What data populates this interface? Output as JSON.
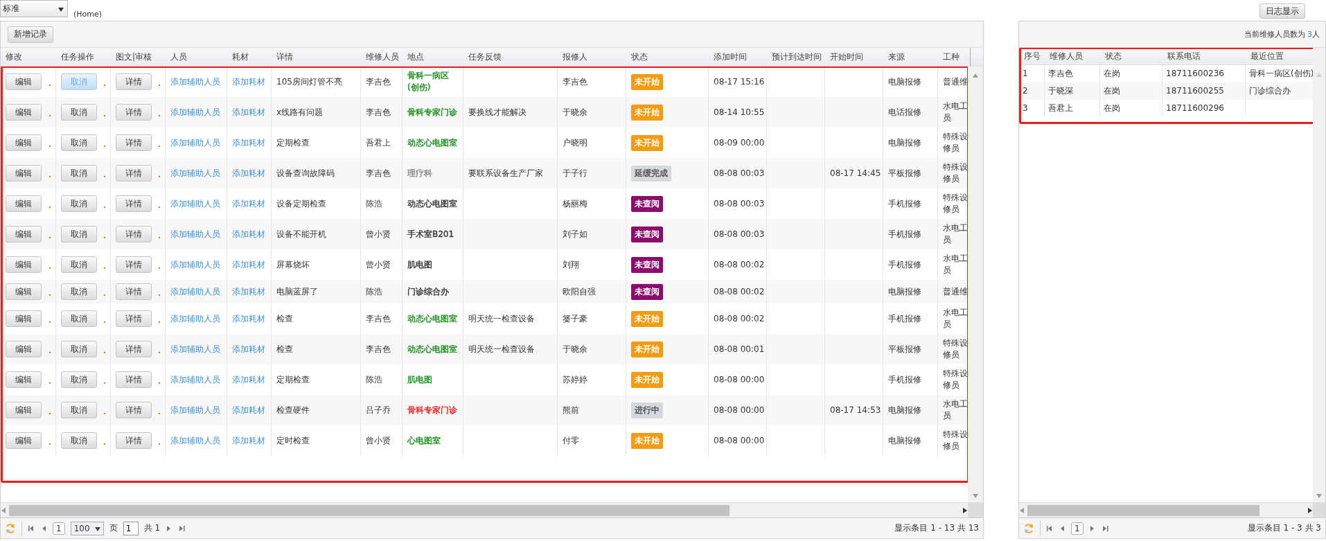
{
  "view_select": {
    "value": "标准"
  },
  "breadcrumb": "(Home)",
  "log_button": "日志显示",
  "main_grid": {
    "highlighted": true,
    "add_button": "新增记录",
    "columns": [
      "修改",
      "任务操作",
      "图文|审核",
      "人员",
      "耗材",
      "详情",
      "维修人员",
      "地点",
      "任务反馈",
      "报修人",
      "状态",
      "添加时间",
      "预计到达时间",
      "开始时间",
      "来源",
      "工种"
    ],
    "rows": [
      {
        "edit": "编辑",
        "cancel": {
          "label": "取消",
          "hovered": true
        },
        "detail": "详情",
        "staff_link": "添加辅助人员",
        "material_link": "添加耗材",
        "description": "105房间灯管不亮",
        "technician": "李吉色",
        "location": {
          "text": "骨科一病区(创伤)",
          "color": "#1a8f1a"
        },
        "feedback": "",
        "reporter": "李吉色",
        "status": {
          "label": "未开始",
          "color": "#f39c12"
        },
        "added": "08-17 15:16",
        "eta": "",
        "started": "",
        "source": "电脑报修",
        "work_type": [
          "普通维"
        ]
      },
      {
        "edit": "编辑",
        "cancel": {
          "label": "取消",
          "hovered": false
        },
        "detail": "详情",
        "staff_link": "添加辅助人员",
        "material_link": "添加耗材",
        "description": "x线路有问题",
        "technician": "李吉色",
        "location": {
          "text": "骨科专家门诊",
          "color": "#1a8f1a"
        },
        "feedback": "要换线才能解决",
        "reporter": "于晓余",
        "status": {
          "label": "未开始",
          "color": "#f39c12"
        },
        "added": "08-14 10:55",
        "eta": "",
        "started": "",
        "source": "电话报修",
        "work_type": [
          "水电工",
          "员"
        ]
      },
      {
        "edit": "编辑",
        "cancel": {
          "label": "取消",
          "hovered": false
        },
        "detail": "详情",
        "staff_link": "添加辅助人员",
        "material_link": "添加耗材",
        "description": "定期检查",
        "technician": "吾君上",
        "location": {
          "text": "动态心电图室",
          "color": "#1a8f1a"
        },
        "feedback": "",
        "reporter": "户晓明",
        "status": {
          "label": "未开始",
          "color": "#f39c12"
        },
        "added": "08-09 00:00",
        "eta": "",
        "started": "",
        "source": "电脑报修",
        "work_type": [
          "特殊设",
          "修员"
        ]
      },
      {
        "edit": "编辑",
        "cancel": {
          "label": "取消",
          "hovered": false
        },
        "detail": "详情",
        "staff_link": "添加辅助人员",
        "material_link": "添加耗材",
        "description": "设备查询故障码",
        "technician": "李吉色",
        "location": {
          "text": "理疗科",
          "color": "#888888"
        },
        "feedback": "要联系设备生产厂家",
        "reporter": "于子行",
        "status": {
          "label": "延缓完成",
          "color": "#d5d8dc"
        },
        "added": "08-08 00:03",
        "eta": "",
        "started": "08-17 14:45",
        "source": "平板报修",
        "work_type": [
          "特殊设",
          "修员"
        ]
      },
      {
        "edit": "编辑",
        "cancel": {
          "label": "取消",
          "hovered": false
        },
        "detail": "详情",
        "staff_link": "添加辅助人员",
        "material_link": "添加耗材",
        "description": "设备定期检查",
        "technician": "陈浩",
        "location": {
          "text": "动态心电图室",
          "color": "#333333"
        },
        "feedback": "",
        "reporter": "杨丽梅",
        "status": {
          "label": "未查阅",
          "color": "#8b0c6e"
        },
        "added": "08-08 00:03",
        "eta": "",
        "started": "",
        "source": "手机报修",
        "work_type": [
          "特殊设",
          "修员"
        ]
      },
      {
        "edit": "编辑",
        "cancel": {
          "label": "取消",
          "hovered": false
        },
        "detail": "详情",
        "staff_link": "添加辅助人员",
        "material_link": "添加耗材",
        "description": "设备不能开机",
        "technician": "曾小贤",
        "location": {
          "text": "手术室B201",
          "color": "#333333"
        },
        "feedback": "",
        "reporter": "刘子如",
        "status": {
          "label": "未查阅",
          "color": "#8b0c6e"
        },
        "added": "08-08 00:03",
        "eta": "",
        "started": "",
        "source": "手机报修",
        "work_type": [
          "水电工",
          "员"
        ]
      },
      {
        "edit": "编辑",
        "cancel": {
          "label": "取消",
          "hovered": false
        },
        "detail": "详情",
        "staff_link": "添加辅助人员",
        "material_link": "添加耗材",
        "description": "屏幕烧坏",
        "technician": "曾小贤",
        "location": {
          "text": "肌电图",
          "color": "#333333"
        },
        "feedback": "",
        "reporter": "刘翔",
        "status": {
          "label": "未查阅",
          "color": "#8b0c6e"
        },
        "added": "08-08 00:02",
        "eta": "",
        "started": "",
        "source": "手机报修",
        "work_type": [
          "水电工",
          "员"
        ]
      },
      {
        "edit": "编辑",
        "cancel": {
          "label": "取消",
          "hovered": false
        },
        "detail": "详情",
        "staff_link": "添加辅助人员",
        "material_link": "添加耗材",
        "description": "电脑蓝屏了",
        "technician": "陈浩",
        "location": {
          "text": "门诊综合办",
          "color": "#333333"
        },
        "feedback": "",
        "reporter": "欧阳自强",
        "status": {
          "label": "未查阅",
          "color": "#8b0c6e"
        },
        "added": "08-08 00:02",
        "eta": "",
        "started": "",
        "source": "电脑报修",
        "work_type": [
          "普通维"
        ]
      },
      {
        "edit": "编辑",
        "cancel": {
          "label": "取消",
          "hovered": false
        },
        "detail": "详情",
        "staff_link": "添加辅助人员",
        "material_link": "添加耗材",
        "description": "检查",
        "technician": "李吉色",
        "location": {
          "text": "动态心电图室",
          "color": "#1a8f1a"
        },
        "feedback": "明天统一检查设备",
        "reporter": "篓子豪",
        "status": {
          "label": "未开始",
          "color": "#f39c12"
        },
        "added": "08-08 00:02",
        "eta": "",
        "started": "",
        "source": "手机报修",
        "work_type": [
          "水电工",
          "员"
        ]
      },
      {
        "edit": "编辑",
        "cancel": {
          "label": "取消",
          "hovered": false
        },
        "detail": "详情",
        "staff_link": "添加辅助人员",
        "material_link": "添加耗材",
        "description": "检查",
        "technician": "李吉色",
        "location": {
          "text": "动态心电图室",
          "color": "#1a8f1a"
        },
        "feedback": "明天统一检查设备",
        "reporter": "于晓余",
        "status": {
          "label": "未开始",
          "color": "#f39c12"
        },
        "added": "08-08 00:01",
        "eta": "",
        "started": "",
        "source": "平板报修",
        "work_type": [
          "特殊设",
          "修员"
        ]
      },
      {
        "edit": "编辑",
        "cancel": {
          "label": "取消",
          "hovered": false
        },
        "detail": "详情",
        "staff_link": "添加辅助人员",
        "material_link": "添加耗材",
        "description": "定期检查",
        "technician": "陈浩",
        "location": {
          "text": "肌电图",
          "color": "#1a8f1a"
        },
        "feedback": "",
        "reporter": "苏婷婷",
        "status": {
          "label": "未开始",
          "color": "#f39c12"
        },
        "added": "08-08 00:00",
        "eta": "",
        "started": "",
        "source": "手机报修",
        "work_type": [
          "特殊设",
          "修员"
        ]
      },
      {
        "edit": "编辑",
        "cancel": {
          "label": "取消",
          "hovered": false
        },
        "detail": "详情",
        "staff_link": "添加辅助人员",
        "material_link": "添加耗材",
        "description": "检查硬件",
        "technician": "吕子乔",
        "location": {
          "text": "骨科专家门诊",
          "color": "#ee2222"
        },
        "feedback": "",
        "reporter": "熊前",
        "status": {
          "label": "进行中",
          "color": "#d5d8dc"
        },
        "added": "08-08 00:00",
        "eta": "",
        "started": "08-17 14:53",
        "source": "电脑报修",
        "work_type": [
          "水电工",
          "员"
        ]
      },
      {
        "edit": "编辑",
        "cancel": {
          "label": "取消",
          "hovered": false
        },
        "detail": "详情",
        "staff_link": "添加辅助人员",
        "material_link": "添加耗材",
        "description": "定时检查",
        "technician": "曾小贤",
        "location": {
          "text": "心电图室",
          "color": "#1a8f1a"
        },
        "feedback": "",
        "reporter": "付零",
        "status": {
          "label": "未开始",
          "color": "#f39c12"
        },
        "added": "08-08 00:00",
        "eta": "",
        "started": "",
        "source": "电脑报修",
        "work_type": [
          "特殊设",
          "修员"
        ]
      }
    ],
    "pager": {
      "page_badge": "1",
      "page_size": "100",
      "page_label": "页",
      "page_input": "1",
      "total_pages": "共 1",
      "summary": "显示条目 1 - 13 共 13"
    }
  },
  "crew_panel": {
    "highlighted": true,
    "count_label": "当前维修人员数为",
    "count": "3",
    "count_unit": "人",
    "columns": [
      "序号",
      "维修人员",
      "状态",
      "联系电话",
      "最近位置"
    ],
    "rows": [
      [
        "1",
        "李吉色",
        "在岗",
        "18711600236",
        "骨科一病区(创伤)"
      ],
      [
        "2",
        "于晓深",
        "在岗",
        "18711600255",
        "门诊综合办"
      ],
      [
        "3",
        "吾君上",
        "在岗",
        "18711600296",
        ""
      ]
    ],
    "pager": {
      "page_badge": "1",
      "summary": "显示条目 1 - 3 共 3"
    }
  }
}
